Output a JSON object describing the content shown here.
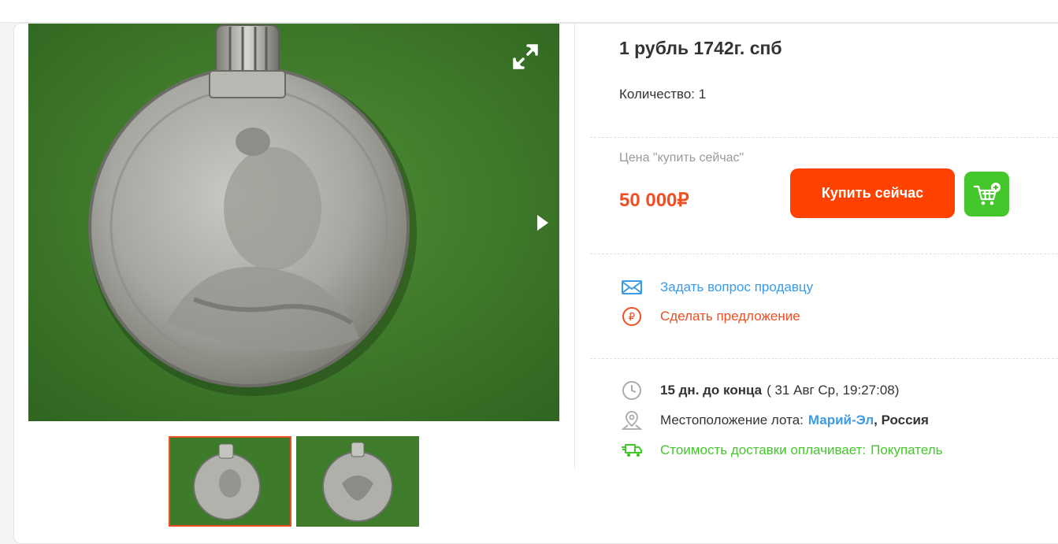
{
  "lot": {
    "title": "1 рубль 1742г. спб",
    "quantity_label": "Количество:",
    "quantity_value": "1"
  },
  "price": {
    "label": "Цена \"купить сейчас\"",
    "value": "50 000₽",
    "buy_now_label": "Купить сейчас"
  },
  "actions": {
    "ask_seller": "Задать вопрос продавцу",
    "make_offer": "Сделать предложение"
  },
  "details": {
    "time_left": "15 дн. до конца",
    "end_date": "( 31 Авг Ср, 19:27:08)",
    "location_label": "Местоположение лота:",
    "region": "Марий-Эл",
    "country": ", Россия",
    "shipping_label": "Стоимость доставки оплачивает:",
    "shipping_payer": "Покупатель"
  },
  "colors": {
    "accent": "#f04e23",
    "buy_button": "#ff4200",
    "cart_button": "#44c72a",
    "link": "#3a9be8",
    "photo_background": "#3f7a2c"
  },
  "icons": [
    "expand-icon",
    "chevron-right-icon",
    "add-to-cart-icon",
    "envelope-icon",
    "ruble-circle-icon",
    "clock-icon",
    "location-pin-icon",
    "delivery-truck-icon"
  ]
}
